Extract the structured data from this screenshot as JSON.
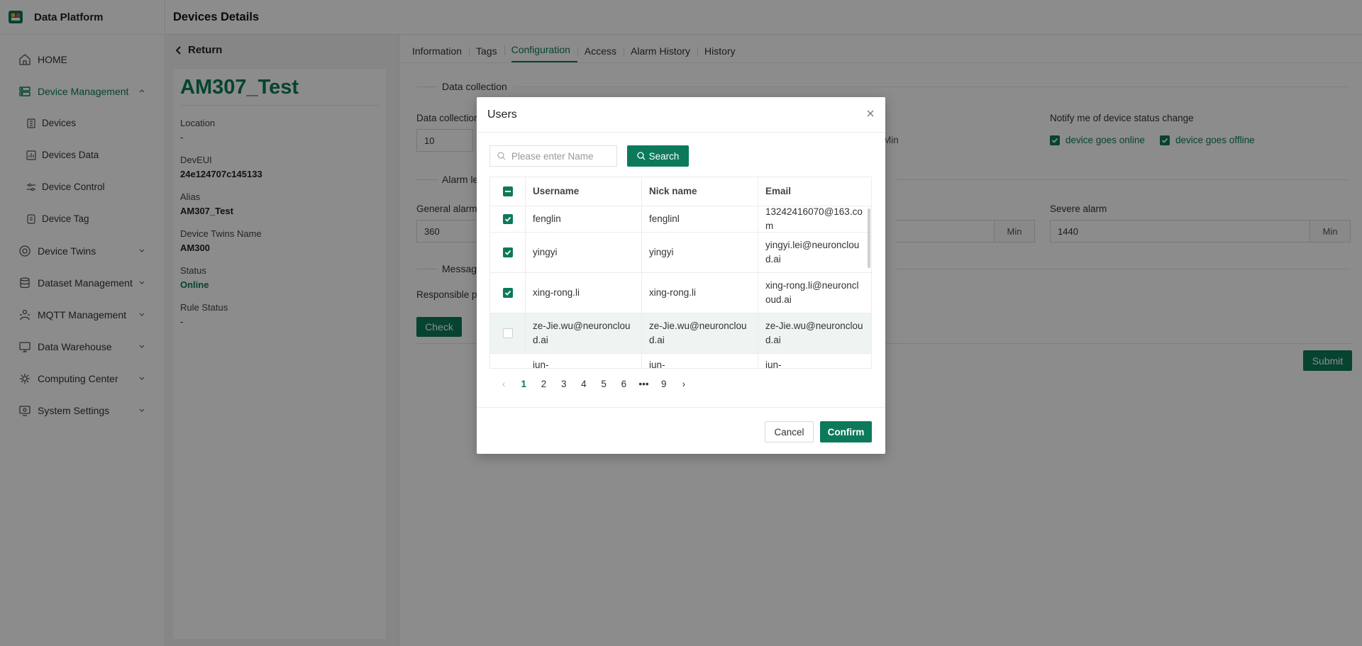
{
  "app": {
    "name": "Data Platform",
    "page_title": "Devices Details"
  },
  "sidebar": {
    "items": [
      {
        "label": "HOME",
        "icon": "home-icon"
      },
      {
        "label": "Device Management",
        "icon": "device-management-icon",
        "active": true,
        "expanded": true
      },
      {
        "label": "Device Twins",
        "icon": "device-twins-icon"
      },
      {
        "label": "Dataset Management",
        "icon": "dataset-icon"
      },
      {
        "label": "MQTT Management",
        "icon": "mqtt-icon"
      },
      {
        "label": "Data Warehouse",
        "icon": "warehouse-icon"
      },
      {
        "label": "Computing Center",
        "icon": "computing-icon"
      },
      {
        "label": "System Settings",
        "icon": "settings-icon"
      }
    ],
    "submenu": [
      {
        "label": "Devices",
        "icon": "devices-icon"
      },
      {
        "label": "Devices Data",
        "icon": "devices-data-icon"
      },
      {
        "label": "Device Control",
        "icon": "device-control-icon"
      },
      {
        "label": "Device Tag",
        "icon": "device-tag-icon"
      }
    ]
  },
  "detail": {
    "return_label": "Return",
    "device_name": "AM307_Test",
    "fields": [
      {
        "label": "Location",
        "value": "-"
      },
      {
        "label": "DevEUI",
        "value": "24e124707c145133"
      },
      {
        "label": "Alias",
        "value": "AM307_Test"
      },
      {
        "label": "Device Twins Name",
        "value": "AM300"
      },
      {
        "label": "Status",
        "value": "Online"
      },
      {
        "label": "Rule Status",
        "value": "-"
      }
    ]
  },
  "main": {
    "tabs": [
      "Information",
      "Tags",
      "Configuration",
      "Access",
      "Alarm History",
      "History"
    ],
    "active_tab": "Configuration",
    "data_collection_title": "Data collection",
    "data_collection_label": "Data collectior",
    "data_collection_value": "10",
    "data_collection_unit": "Min",
    "notify_label": "Notify me of device status change",
    "notify_online": "device goes online",
    "notify_offline": "device goes offline",
    "alarm_title": "Alarm le",
    "general_alarm_label": "General alarm",
    "general_alarm_value": "360",
    "mid_alarm_unit": "Min",
    "severe_alarm_label": "Severe alarm",
    "severe_alarm_value": "1440",
    "severe_alarm_unit": "Min",
    "message_title": "Message",
    "responsible_label": "Responsible pe",
    "check_label": "Check",
    "submit_label": "Submit"
  },
  "modal": {
    "title": "Users",
    "search_placeholder": "Please enter Name",
    "search_label": "Search",
    "columns": [
      "Username",
      "Nick name",
      "Email"
    ],
    "rows": [
      {
        "username": "fenglin",
        "nickname": "fenglinl",
        "email": "13242416070@163.com",
        "checked": true
      },
      {
        "username": "yingyi",
        "nickname": "yingyi",
        "email": "yingyi.lei@neuroncloud.ai",
        "checked": true
      },
      {
        "username": "xing-rong.li",
        "nickname": "xing-rong.li",
        "email": "xing-rong.li@neuroncloud.ai",
        "checked": true
      },
      {
        "username": "ze-Jie.wu@neuroncloud.ai",
        "nickname": "ze-Jie.wu@neuroncloud.ai",
        "email": "ze-Jie.wu@neuroncloud.ai",
        "checked": false
      },
      {
        "username": "jun-",
        "nickname": "jun-",
        "email": "jun-",
        "checked": false
      }
    ],
    "pages": [
      "1",
      "2",
      "3",
      "4",
      "5",
      "6",
      "•••",
      "9"
    ],
    "current_page": "1",
    "cancel_label": "Cancel",
    "confirm_label": "Confirm"
  },
  "colors": {
    "accent": "#0c7a5a",
    "overlay": "rgba(0,0,0,0.45)"
  }
}
